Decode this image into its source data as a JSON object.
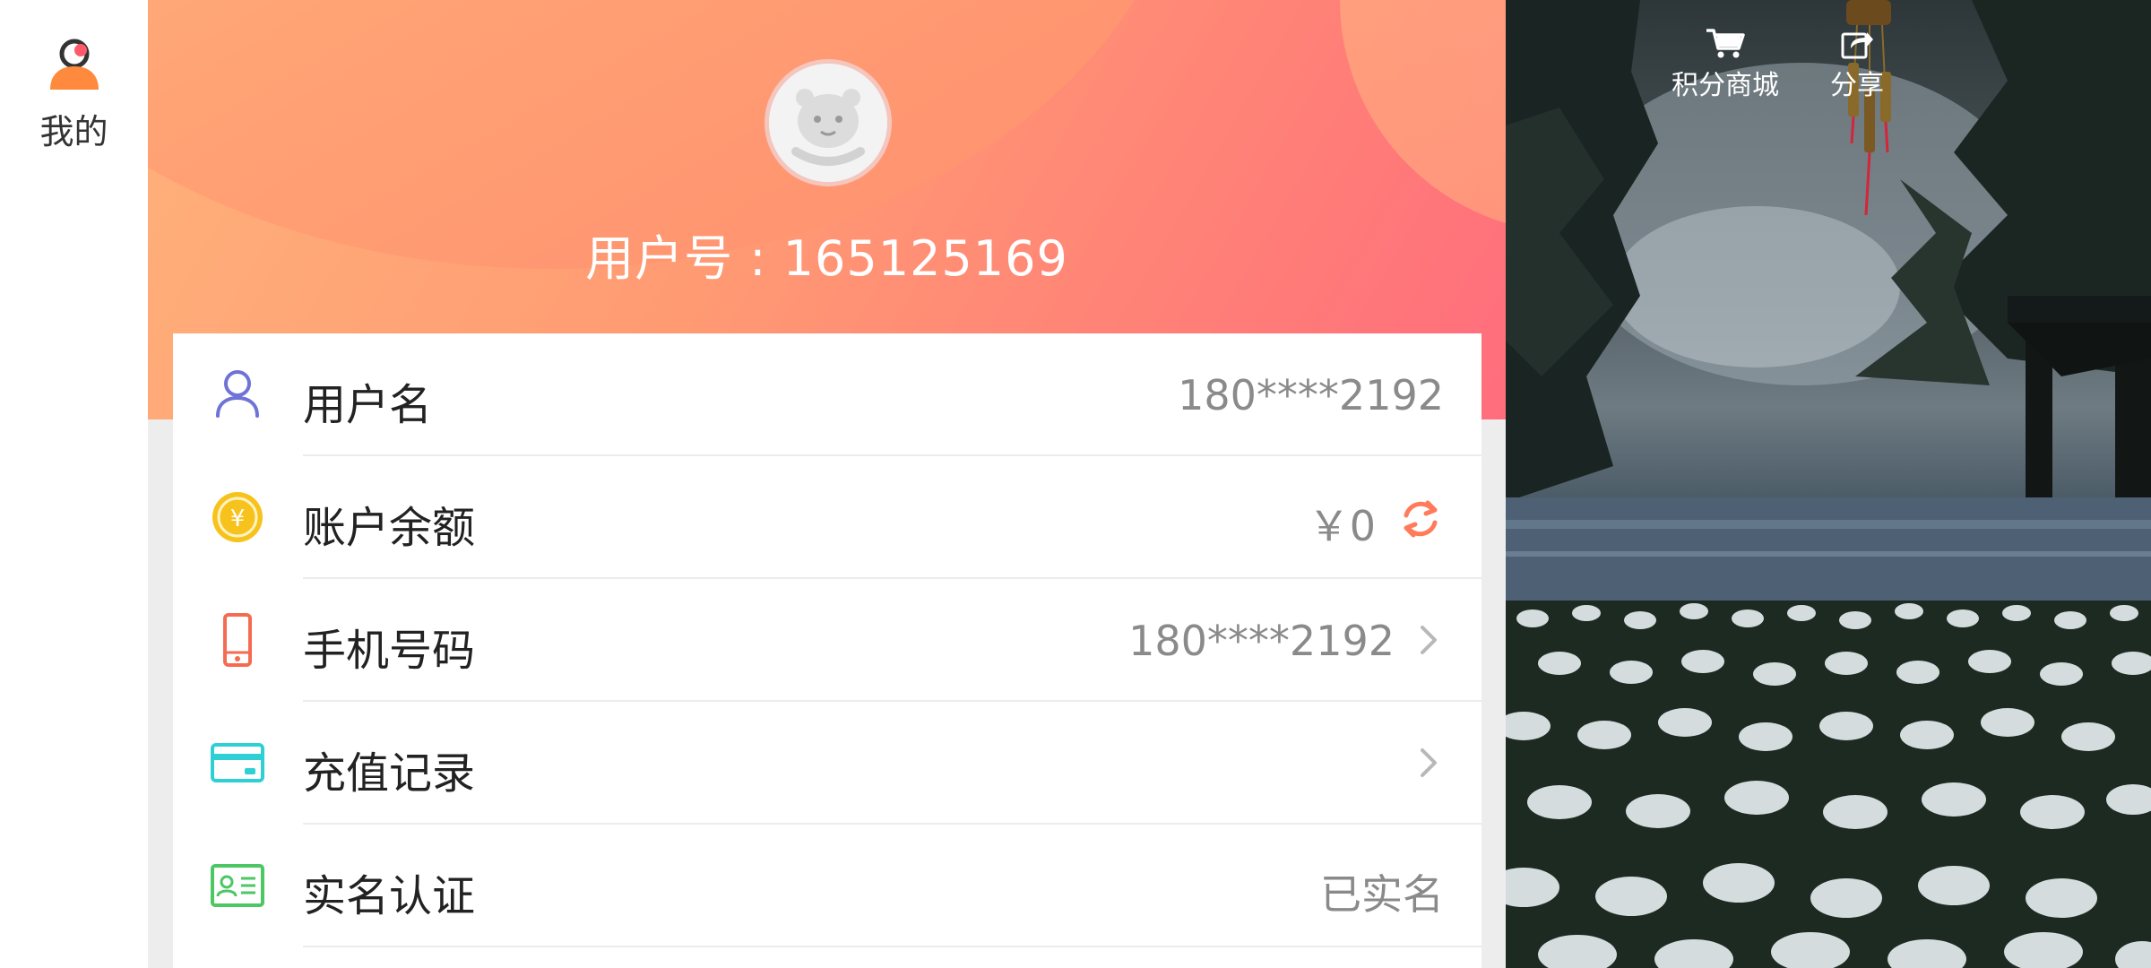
{
  "rail": {
    "tab_label": "我的",
    "tab_icon": "user-icon"
  },
  "header": {
    "user_id_text": "用户号 : 165125169"
  },
  "rows": [
    {
      "label": "用户名",
      "value": "180****2192",
      "icon": "person-icon"
    },
    {
      "label": "账户余额",
      "value": "￥0",
      "icon": "coin-yuan-icon",
      "action_icon": "refresh-icon"
    },
    {
      "label": "手机号码",
      "value": "180****2192",
      "icon": "phone-icon",
      "action_icon": "chevron-right-icon"
    },
    {
      "label": "充值记录",
      "value": "",
      "icon": "card-icon",
      "action_icon": "chevron-right-icon"
    },
    {
      "label": "实名认证",
      "value": "已实名",
      "icon": "id-card-icon"
    }
  ],
  "scene": {
    "actions": [
      {
        "label": "积分商城",
        "icon": "cart-icon"
      },
      {
        "label": "分享",
        "icon": "share-icon"
      }
    ]
  },
  "colors": {
    "accent_orange": "#ff7b5a",
    "person_icon": "#6f73d8",
    "coin_icon": "#f7c21b",
    "phone_icon": "#f56b52",
    "card_icon": "#2fd0d5",
    "idcard_icon": "#4cc764"
  }
}
